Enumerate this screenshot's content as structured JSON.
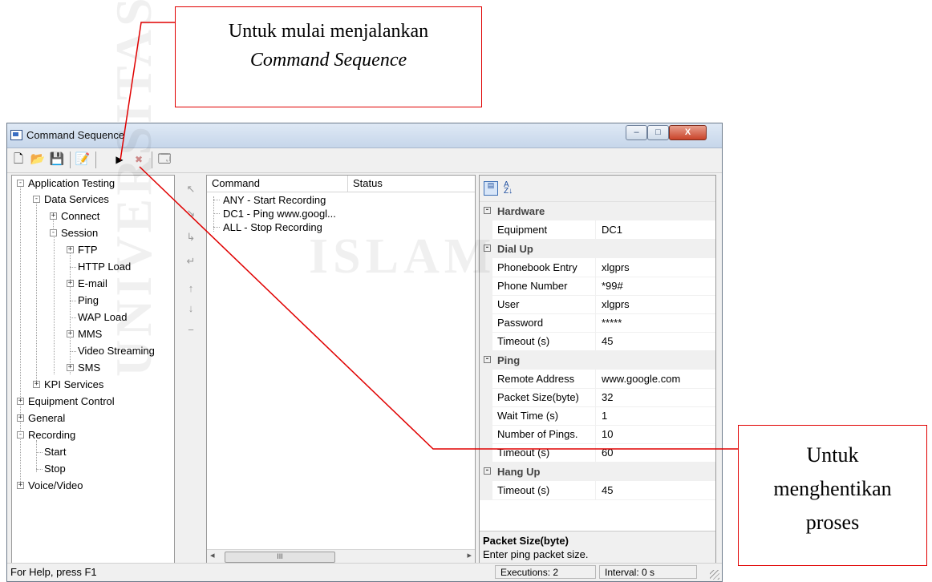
{
  "annotations": {
    "top_line1": "Untuk mulai menjalankan",
    "top_line2": "Command Sequence",
    "right_line1": "Untuk",
    "right_line2": "menghentikan",
    "right_line3": "proses"
  },
  "window": {
    "title": "Command Sequence",
    "minimize": "–",
    "maximize": "□",
    "close": "X"
  },
  "toolbar": {
    "icons": [
      "new-document-icon",
      "open-folder-icon",
      "save-icon",
      "edit-icon",
      "start-sequence-icon",
      "stop-sequence-icon",
      "properties-icon"
    ],
    "glyphs": [
      "🗋",
      "📂",
      "💾",
      "📝",
      "▶",
      "✖",
      "🗔"
    ]
  },
  "tree": {
    "items": [
      {
        "label": "Application Testing",
        "toggle": "-"
      },
      {
        "label": "Data Services",
        "toggle": "-"
      },
      {
        "label": "Connect",
        "toggle": "+"
      },
      {
        "label": "Session",
        "toggle": "-"
      },
      {
        "label": "FTP",
        "toggle": "+"
      },
      {
        "label": "HTTP Load",
        "toggle": ""
      },
      {
        "label": "E-mail",
        "toggle": "+"
      },
      {
        "label": "Ping",
        "toggle": ""
      },
      {
        "label": "WAP Load",
        "toggle": ""
      },
      {
        "label": "MMS",
        "toggle": "+"
      },
      {
        "label": "Video Streaming",
        "toggle": ""
      },
      {
        "label": "SMS",
        "toggle": "+"
      },
      {
        "label": "KPI Services",
        "toggle": "+"
      },
      {
        "label": "Equipment Control",
        "toggle": "+"
      },
      {
        "label": "General",
        "toggle": "+"
      },
      {
        "label": "Recording",
        "toggle": "-"
      },
      {
        "label": "Start",
        "toggle": ""
      },
      {
        "label": "Stop",
        "toggle": ""
      },
      {
        "label": "Voice/Video",
        "toggle": "+"
      }
    ]
  },
  "sequence_buttons": [
    "↖",
    "↘",
    "↳",
    "↵",
    "↑",
    "↓",
    "−"
  ],
  "commands": {
    "col_command": "Command",
    "col_status": "Status",
    "rows": [
      "ANY - Start Recording",
      "DC1 - Ping www.googl...",
      "ALL - Stop Recording"
    ],
    "scroll_grip": "III",
    "scroll_left": "◂",
    "scroll_right": "▸"
  },
  "properties": {
    "sort_icons": [
      "categorized-icon",
      "alphabetical-sort-icon"
    ],
    "az": "A Z↓",
    "collapse": "-",
    "hardware": {
      "title": "Hardware",
      "equipment_label": "Equipment",
      "equipment_value": "DC1"
    },
    "dialup": {
      "title": "Dial Up",
      "phonebook_label": "Phonebook Entry",
      "phonebook_value": "xlgprs",
      "phone_label": "Phone Number",
      "phone_value": "*99#",
      "user_label": "User",
      "user_value": "xlgprs",
      "password_label": "Password",
      "password_value": "*****",
      "timeout_label": "Timeout (s)",
      "timeout_value": "45"
    },
    "ping": {
      "title": "Ping",
      "remote_label": "Remote Address",
      "remote_value": "www.google.com",
      "packet_label": "Packet Size(byte)",
      "packet_value": "32",
      "wait_label": "Wait Time (s)",
      "wait_value": "1",
      "number_label": "Number of Pings.",
      "number_value": "10",
      "timeout_label": "Timeout (s)",
      "timeout_value": "60"
    },
    "hangup": {
      "title": "Hang Up",
      "timeout_label": "Timeout (s)",
      "timeout_value": "45"
    },
    "description_title": "Packet Size(byte)",
    "description_text": "Enter ping packet size."
  },
  "status": {
    "help": "For Help, press F1",
    "executions": "Executions: 2",
    "interval": "Interval: 0 s"
  },
  "watermark": {
    "top": "ISLAM",
    "side": "UNIVERSITAS"
  }
}
